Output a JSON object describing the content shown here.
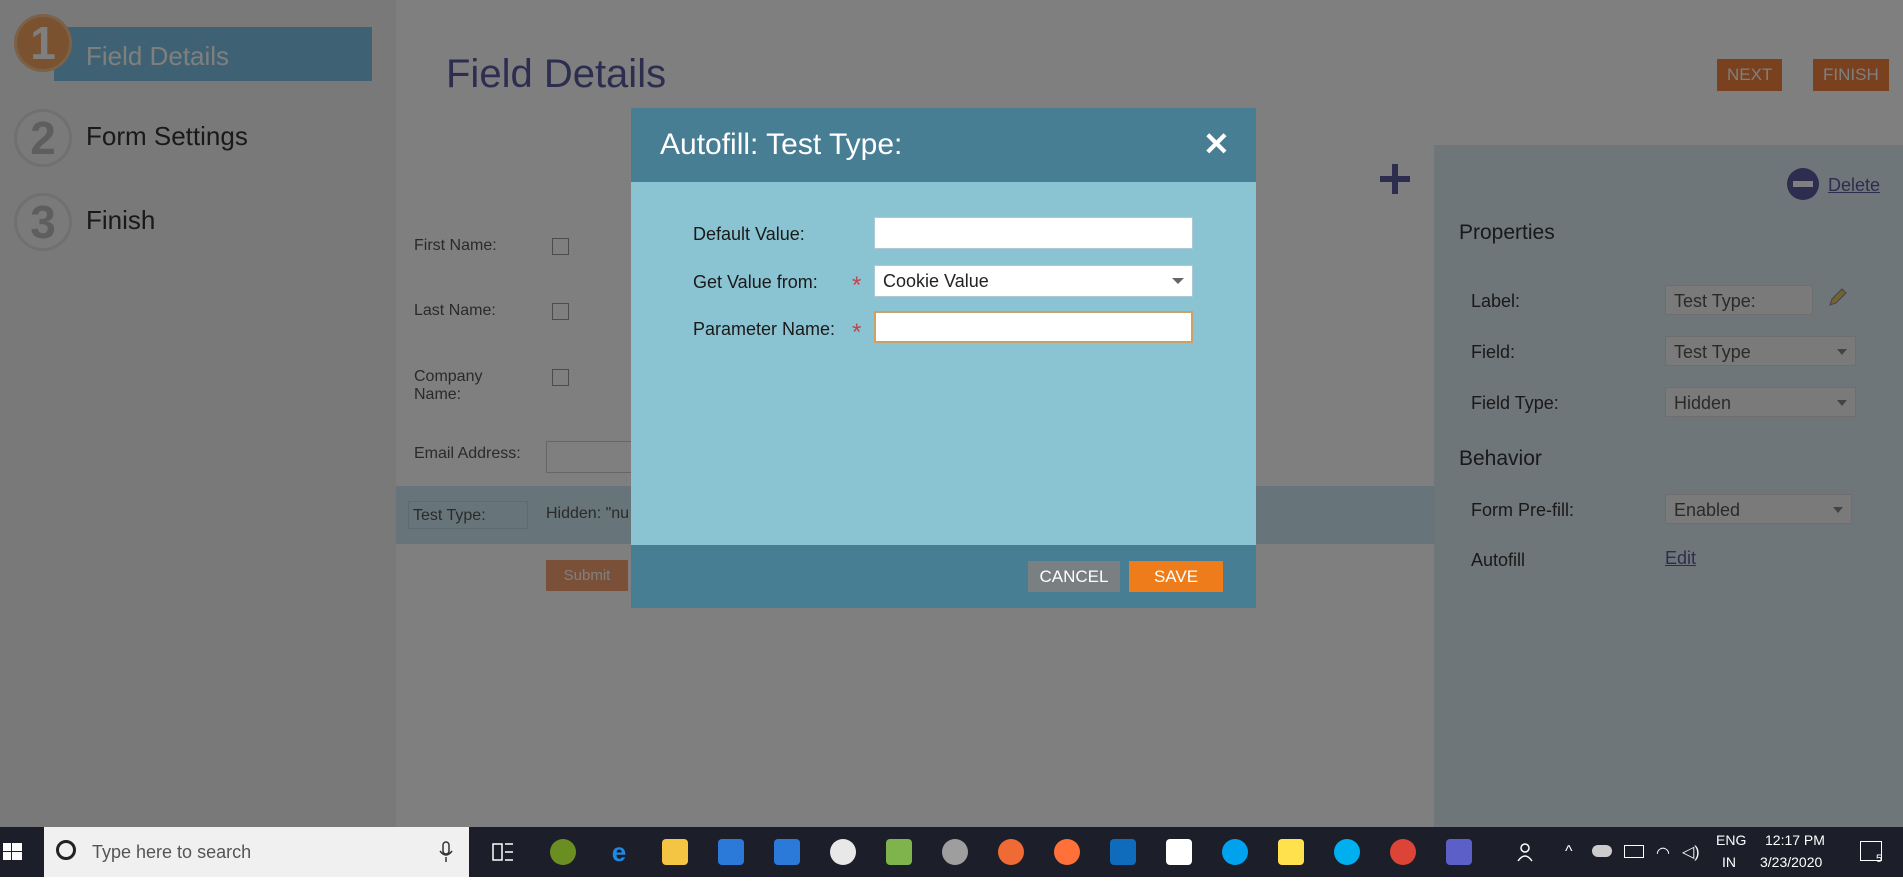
{
  "steps": [
    {
      "num": "1",
      "label": "Field Details",
      "active": true
    },
    {
      "num": "2",
      "label": "Form Settings",
      "active": false
    },
    {
      "num": "3",
      "label": "Finish",
      "active": false
    }
  ],
  "header": {
    "title": "Field Details",
    "next_label": "NEXT",
    "finish_label": "FINISH"
  },
  "form": {
    "fields": [
      {
        "label": "First Name:"
      },
      {
        "label": "Last Name:"
      },
      {
        "label": "Company Name:"
      },
      {
        "label": "Email Address:"
      }
    ],
    "selected_field_label": "Test Type:",
    "selected_field_value": "Hidden: \"nu",
    "submit_label": "Submit"
  },
  "properties": {
    "delete_label": "Delete",
    "section_title": "Properties",
    "label_label": "Label:",
    "label_value": "Test Type:",
    "field_label": "Field:",
    "field_value": "Test Type",
    "field_type_label": "Field Type:",
    "field_type_value": "Hidden",
    "behavior_title": "Behavior",
    "prefill_label": "Form Pre-fill:",
    "prefill_value": "Enabled",
    "autofill_label": "Autofill",
    "autofill_link": "Edit"
  },
  "modal": {
    "title": "Autofill: Test Type:",
    "close_glyph": "✕",
    "default_value_label": "Default Value:",
    "default_value": "",
    "get_value_label": "Get Value from:",
    "get_value_selected": "Cookie Value",
    "parameter_name_label": "Parameter Name:",
    "parameter_name_value": "",
    "required_mark": "*",
    "cancel_label": "CANCEL",
    "save_label": "SAVE",
    "colors": {
      "header": "#477e93",
      "body": "#8ac3d2",
      "save": "#ee7c1a",
      "cancel": "#7a7f82"
    }
  },
  "taskbar": {
    "search_placeholder": "Type here to search",
    "lang_line1": "ENG",
    "lang_line2": "IN",
    "time": "12:17 PM",
    "date": "3/23/2020",
    "notification_count": "5",
    "app_icons": [
      "task-view",
      "app-p",
      "edge",
      "file-explorer",
      "store",
      "mail",
      "paint",
      "notepad",
      "settings",
      "swift",
      "firefox",
      "outlook",
      "calculator",
      "skype-business",
      "sticky-notes",
      "skype",
      "chrome",
      "teams"
    ]
  }
}
